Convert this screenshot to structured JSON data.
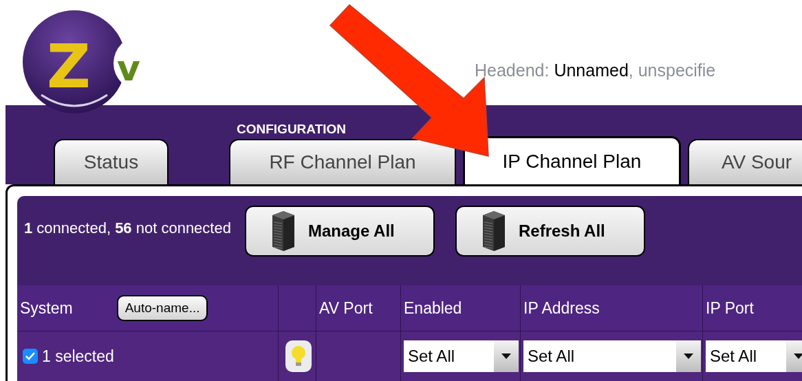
{
  "logo": {
    "letter_1": "Z",
    "letter_2": "v"
  },
  "headend": {
    "label": "Headend:",
    "name": "Unnamed",
    "rest": ", unspecifie"
  },
  "section_label": "CONFIGURATION",
  "tabs": [
    {
      "label": "Status",
      "selected": false
    },
    {
      "label": "RF Channel Plan",
      "selected": false
    },
    {
      "label": "IP Channel Plan",
      "selected": true
    },
    {
      "label": "AV Sour",
      "selected": false
    }
  ],
  "toolbar": {
    "summary": "**1** connected, **56** not connected",
    "buttons": [
      "Manage All",
      "Refresh All"
    ]
  },
  "table": {
    "columns": [
      {
        "kind": "system",
        "label": "System",
        "button": "Auto-name..."
      },
      {
        "kind": "bulb"
      },
      {
        "kind": "text",
        "label": "AV Port"
      },
      {
        "kind": "select",
        "label": "Enabled"
      },
      {
        "kind": "select",
        "label": "IP Address"
      },
      {
        "kind": "select",
        "label": "IP Port"
      }
    ],
    "selection_row": {
      "checked": true,
      "label": "1 selected",
      "selects": [
        "Set All",
        "Set All",
        "Set All"
      ]
    }
  }
}
